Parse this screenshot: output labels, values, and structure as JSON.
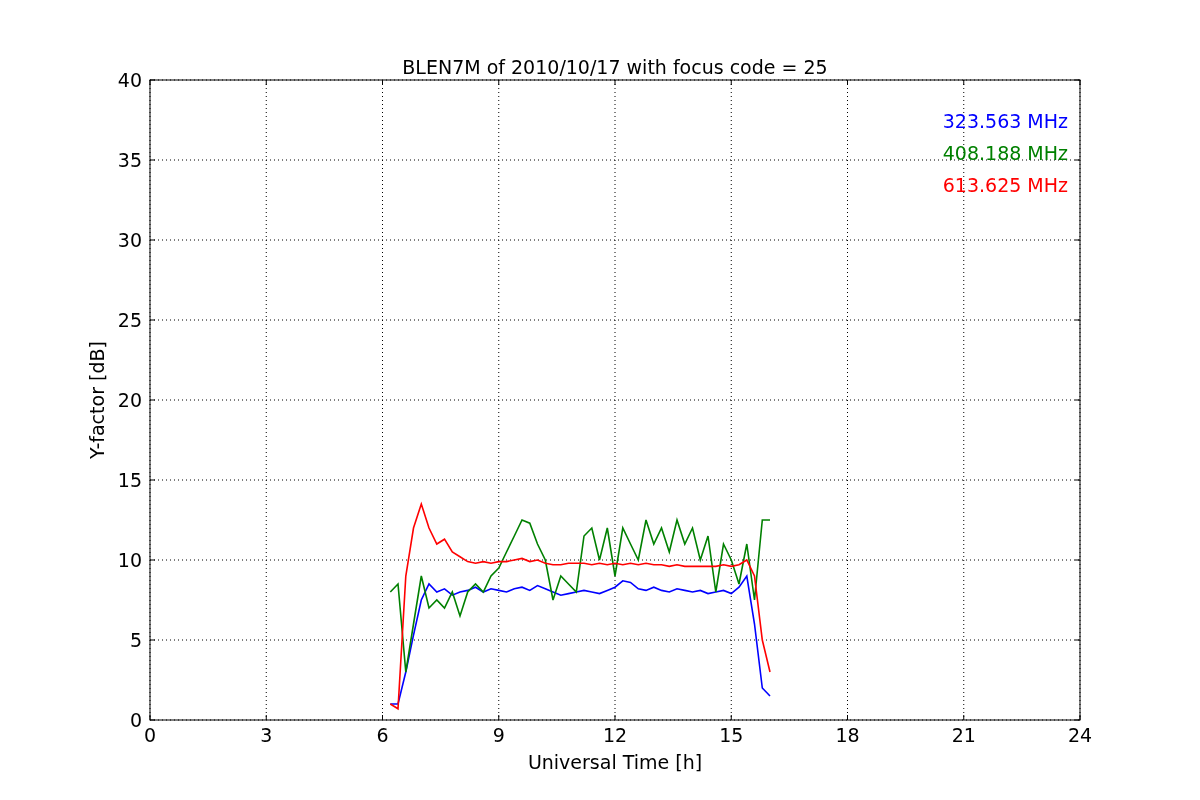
{
  "figure": {
    "chart_data": {
      "type": "line",
      "title": "BLEN7M of 2010/10/17 with focus code = 25",
      "xlabel": "Universal Time [h]",
      "ylabel": "Y-factor [dB]",
      "x": [
        6.2,
        6.4,
        6.6,
        6.8,
        7.0,
        7.2,
        7.4,
        7.6,
        7.8,
        8.0,
        8.2,
        8.4,
        8.6,
        8.8,
        9.0,
        9.2,
        9.4,
        9.6,
        9.8,
        10.0,
        10.2,
        10.4,
        10.6,
        10.8,
        11.0,
        11.2,
        11.4,
        11.6,
        11.8,
        12.0,
        12.2,
        12.4,
        12.6,
        12.8,
        13.0,
        13.2,
        13.4,
        13.6,
        13.8,
        14.0,
        14.2,
        14.4,
        14.6,
        14.8,
        15.0,
        15.2,
        15.4,
        15.6,
        15.8,
        16.0
      ],
      "series": [
        {
          "name": "323.563 MHz",
          "color": "#0000ff",
          "values": [
            1,
            1,
            3,
            5.3,
            7.5,
            8.5,
            8,
            8.2,
            7.8,
            8,
            8.1,
            8.3,
            8,
            8.2,
            8.1,
            8,
            8.2,
            8.3,
            8.1,
            8.4,
            8.2,
            8,
            7.8,
            7.9,
            8,
            8.1,
            8,
            7.9,
            8.1,
            8.3,
            8.7,
            8.6,
            8.2,
            8.1,
            8.3,
            8.1,
            8,
            8.2,
            8.1,
            8,
            8.1,
            7.9,
            8,
            8.1,
            7.9,
            8.3,
            9,
            6,
            2,
            1.5
          ]
        },
        {
          "name": "408.188 MHz",
          "color": "#008000",
          "values": [
            8,
            8.5,
            3,
            6,
            9,
            7,
            7.5,
            7,
            8,
            6.5,
            8,
            8.5,
            8,
            9,
            9.5,
            10.5,
            11.5,
            12.5,
            12.3,
            11,
            10,
            7.5,
            9,
            8.5,
            8,
            11.5,
            12,
            10,
            12,
            9,
            12,
            11,
            10,
            12.5,
            11,
            12,
            10.5,
            12.5,
            11,
            12,
            10,
            11.5,
            8,
            11,
            10,
            8.5,
            11,
            7.5,
            12.5,
            12.5
          ]
        },
        {
          "name": "613.625 MHz",
          "color": "#ff0000",
          "values": [
            1,
            0.7,
            9,
            12,
            13.5,
            12,
            11,
            11.3,
            10.5,
            10.2,
            9.9,
            9.8,
            9.9,
            9.8,
            9.9,
            9.9,
            10,
            10.1,
            9.9,
            10,
            9.8,
            9.7,
            9.7,
            9.8,
            9.8,
            9.8,
            9.7,
            9.8,
            9.7,
            9.8,
            9.7,
            9.8,
            9.7,
            9.8,
            9.7,
            9.7,
            9.6,
            9.7,
            9.6,
            9.6,
            9.6,
            9.6,
            9.6,
            9.7,
            9.6,
            9.7,
            10,
            9,
            5,
            3
          ]
        }
      ],
      "grid": true,
      "xlim": [
        0,
        24
      ],
      "ylim": [
        0,
        40
      ],
      "xticks": [
        0,
        3,
        6,
        9,
        12,
        15,
        18,
        21,
        24
      ],
      "yticks": [
        0,
        5,
        10,
        15,
        20,
        25,
        30,
        35,
        40
      ]
    }
  }
}
